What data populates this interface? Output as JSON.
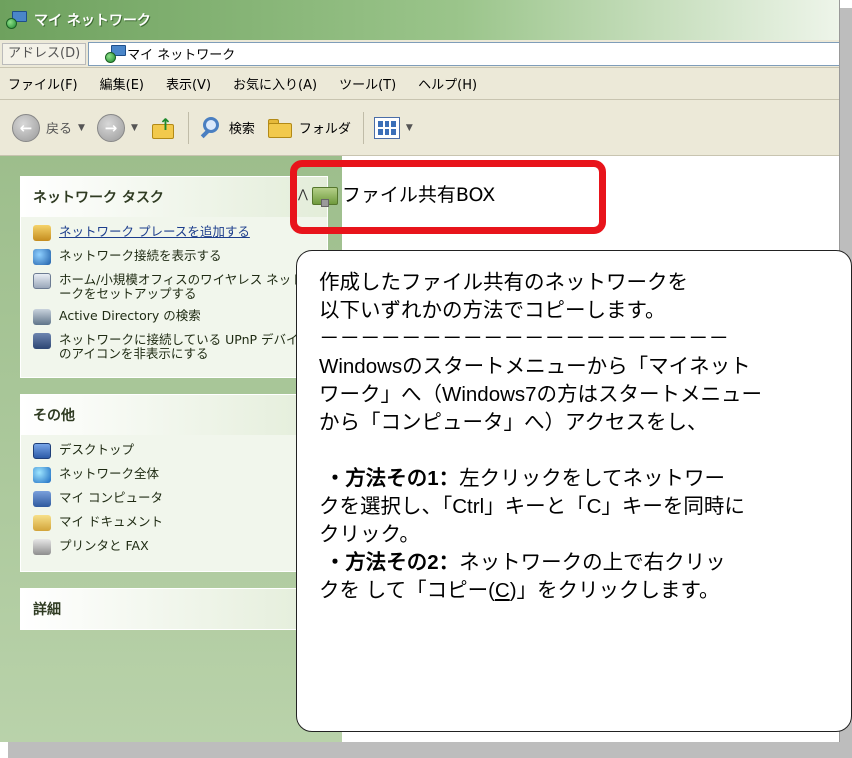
{
  "window": {
    "title": "マイ ネットワーク"
  },
  "address": {
    "label": "アドレス(D)",
    "value": "マイ ネットワーク"
  },
  "menu": [
    "ファイル(F)",
    "編集(E)",
    "表示(V)",
    "お気に入り(A)",
    "ツール(T)",
    "ヘルプ(H)"
  ],
  "toolbar": {
    "back": "戻る",
    "search": "検索",
    "folders": "フォルダ"
  },
  "sidebar": {
    "network_tasks": {
      "title": "ネットワーク タスク",
      "items": [
        "ネットワーク プレースを追加する",
        "ネットワーク接続を表示する",
        "ホーム/小規模オフィスのワイヤレス ネットワークをセットアップする",
        "Active Directory の検索",
        "ネットワークに接続している UPnP デバイスのアイコンを非表示にする"
      ]
    },
    "other": {
      "title": "その他",
      "items": [
        "デスクトップ",
        "ネットワーク全体",
        "マイ コンピュータ",
        "マイ ドキュメント",
        "プリンタと FAX"
      ]
    },
    "details": {
      "title": "詳細"
    }
  },
  "content": {
    "item_name": "ファイル共有BOX"
  },
  "callout": {
    "line1": "作成したファイル共有のネットワークを",
    "line2": "以下いずれかの方法でコピーします。",
    "divider": "－－－－－－－－－－－－－－－－－－－－",
    "line3": "Windowsのスタートメニューから「マイネット",
    "line4": "ワーク」へ（Windows7の方はスタートメニュー",
    "line5": "から「コンピュータ」へ）アクセスをし、",
    "method1_label": "・方法その1：",
    "method1_text1": "左クリックをしてネットワー",
    "method1_text2": "クを選択し、「Ctrl」キーと「C」キーを同時に",
    "method1_text3": "クリック。",
    "method2_label": "・方法その2：",
    "method2_text1": "ネットワークの上で右クリッ",
    "method2_text2a": "クを して「コピー(",
    "method2_key": "C",
    "method2_text2b": ")」をクリックします。"
  }
}
